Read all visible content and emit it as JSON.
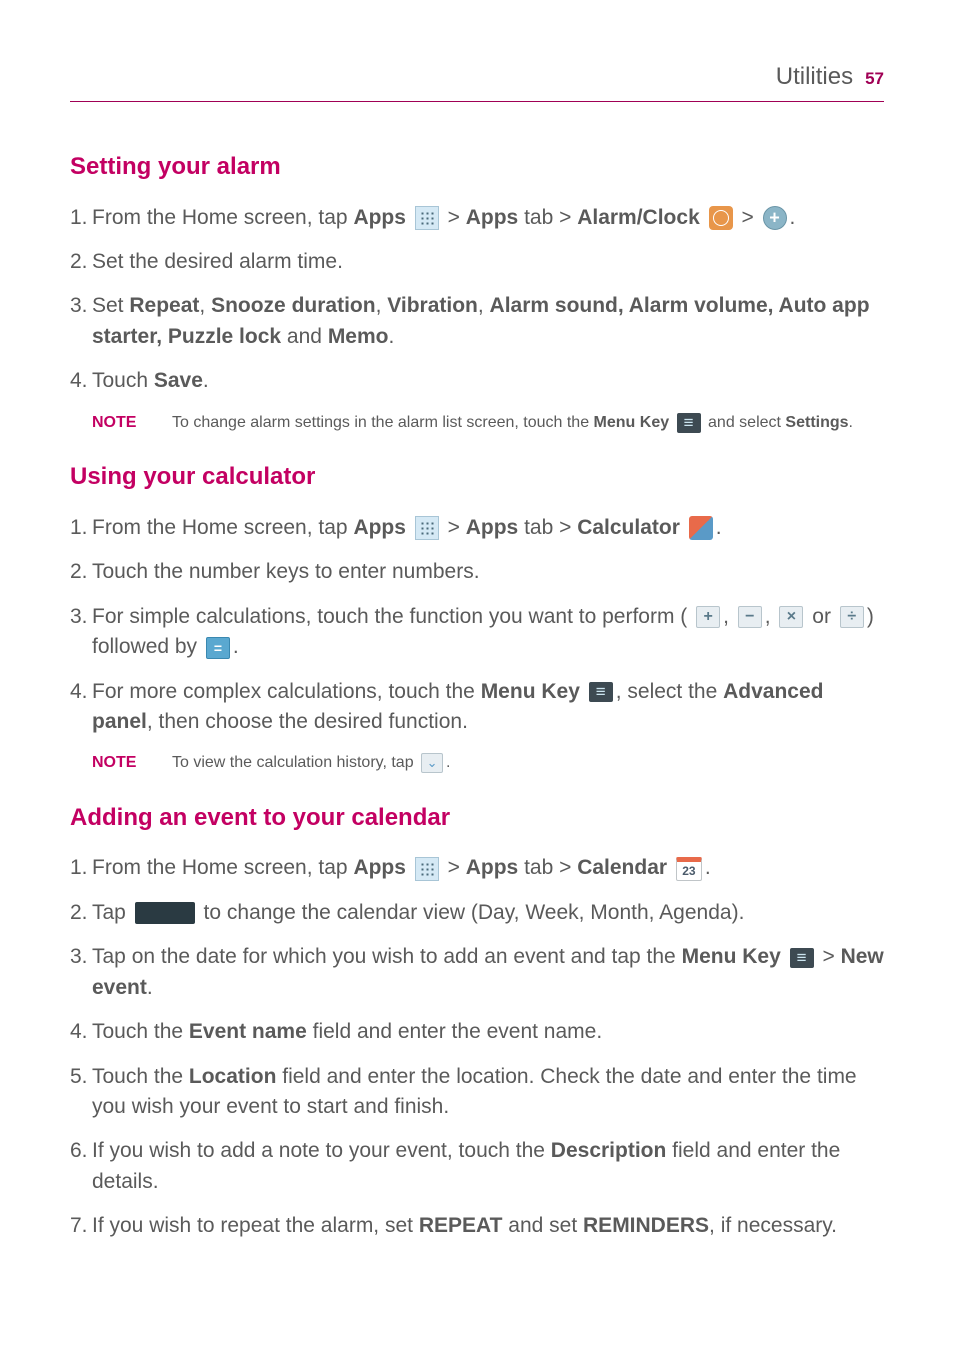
{
  "header": {
    "section": "Utilities",
    "page": "57"
  },
  "s1": {
    "heading": "Setting your alarm",
    "step1_a": "From the Home screen, tap ",
    "step1_apps": "Apps",
    "step1_b": " > ",
    "step1_appstab": "Apps",
    "step1_c": " tab > ",
    "step1_alarm": "Alarm/Clock",
    "step1_d": " > ",
    "step1_e": ".",
    "step2": "Set the desired alarm time.",
    "step3_a": "Set ",
    "step3_repeat": "Repeat",
    "step3_b": ", ",
    "step3_snooze": "Snooze duration",
    "step3_c": ", ",
    "step3_vib": "Vibration",
    "step3_d": ", ",
    "step3_sound": "Alarm sound, Alarm volume, Auto app starter, Puzzle lock",
    "step3_e": " and ",
    "step3_memo": "Memo",
    "step3_f": ".",
    "step4_a": "Touch ",
    "step4_save": "Save",
    "step4_b": ".",
    "note_label": "NOTE",
    "note_a": "To change alarm settings in the alarm list screen, touch the ",
    "note_menu": "Menu Key",
    "note_b": " and select ",
    "note_settings": "Settings",
    "note_c": "."
  },
  "s2": {
    "heading": "Using your calculator",
    "step1_a": "From the Home screen, tap ",
    "step1_apps": "Apps",
    "step1_b": " > ",
    "step1_appstab": "Apps",
    "step1_c": " tab > ",
    "step1_calc": "Calculator",
    "step1_d": ".",
    "step2": "Touch the number keys to enter numbers.",
    "step3_a": "For simple calculations, touch the function you want to perform (",
    "step3_b": ", ",
    "step3_c": ", ",
    "step3_d": " or ",
    "step3_e": ") followed by ",
    "step3_f": ".",
    "step4_a": "For more complex calculations, touch the ",
    "step4_menu": "Menu Key",
    "step4_b": ", select the ",
    "step4_adv": "Advanced panel",
    "step4_c": ", then choose the desired function.",
    "note_label": "NOTE",
    "note_a": "To view the calculation history, tap ",
    "note_b": "."
  },
  "s3": {
    "heading": "Adding an event to your calendar",
    "step1_a": "From the Home screen, tap ",
    "step1_apps": "Apps",
    "step1_b": " > ",
    "step1_appstab": "Apps",
    "step1_c": " tab > ",
    "step1_cal": "Calendar",
    "step1_d": ".",
    "calendar_day": "23",
    "step2_a": "Tap ",
    "step2_b": " to change the calendar view (Day, Week, Month, Agenda).",
    "step3_a": "Tap on the date for which you wish to add an event and tap the ",
    "step3_menu": "Menu Key",
    "step3_b": " > ",
    "step3_new": "New event",
    "step3_c": ".",
    "step4_a": "Touch the ",
    "step4_ev": "Event name",
    "step4_b": " field and enter the event name.",
    "step5_a": "Touch the ",
    "step5_loc": "Location",
    "step5_b": " field and enter the location. Check the date and enter the time you wish your event to start and finish.",
    "step6_a": "If you wish to add a note to your event, touch the ",
    "step6_desc": "Description",
    "step6_b": " field and enter the details.",
    "step7_a": "If you wish to repeat the alarm, set ",
    "step7_rep": "REPEAT",
    "step7_b": " and set ",
    "step7_rem": "REMINDERS",
    "step7_c": ", if necessary."
  },
  "nums": {
    "n1": "1.",
    "n2": "2.",
    "n3": "3.",
    "n4": "4.",
    "n5": "5.",
    "n6": "6.",
    "n7": "7."
  },
  "ops": {
    "plus": "+",
    "minus": "−",
    "mult": "×",
    "div": "÷",
    "eq": "=",
    "down": "⌄"
  }
}
